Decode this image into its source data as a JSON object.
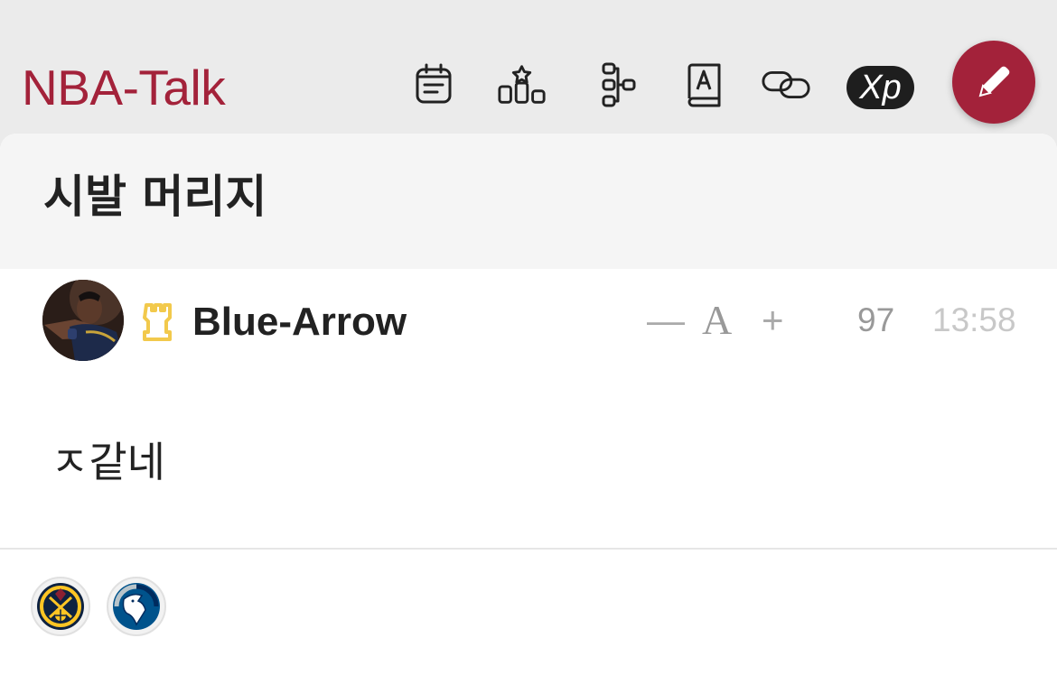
{
  "app": {
    "title": "NBA-Talk"
  },
  "toolbar": {
    "icons": [
      "calendar-icon",
      "ranking-icon",
      "bracket-icon",
      "dictionary-icon",
      "link-icon",
      "xp-icon",
      "pencil-icon"
    ],
    "xp_label": "Xp"
  },
  "post": {
    "title": "시발 머리지",
    "author": "Blue-Arrow",
    "font_controls": {
      "decrease": "—",
      "font": "A",
      "increase": "+"
    },
    "views": "97",
    "time": "13:58",
    "body": "ㅈ같네"
  },
  "teams": [
    "denver-nuggets-logo",
    "dallas-mavericks-logo"
  ],
  "colors": {
    "brand": "#a3223a",
    "xp_badge": "#1e1e1e",
    "rank_icon": "#f2c94c"
  }
}
